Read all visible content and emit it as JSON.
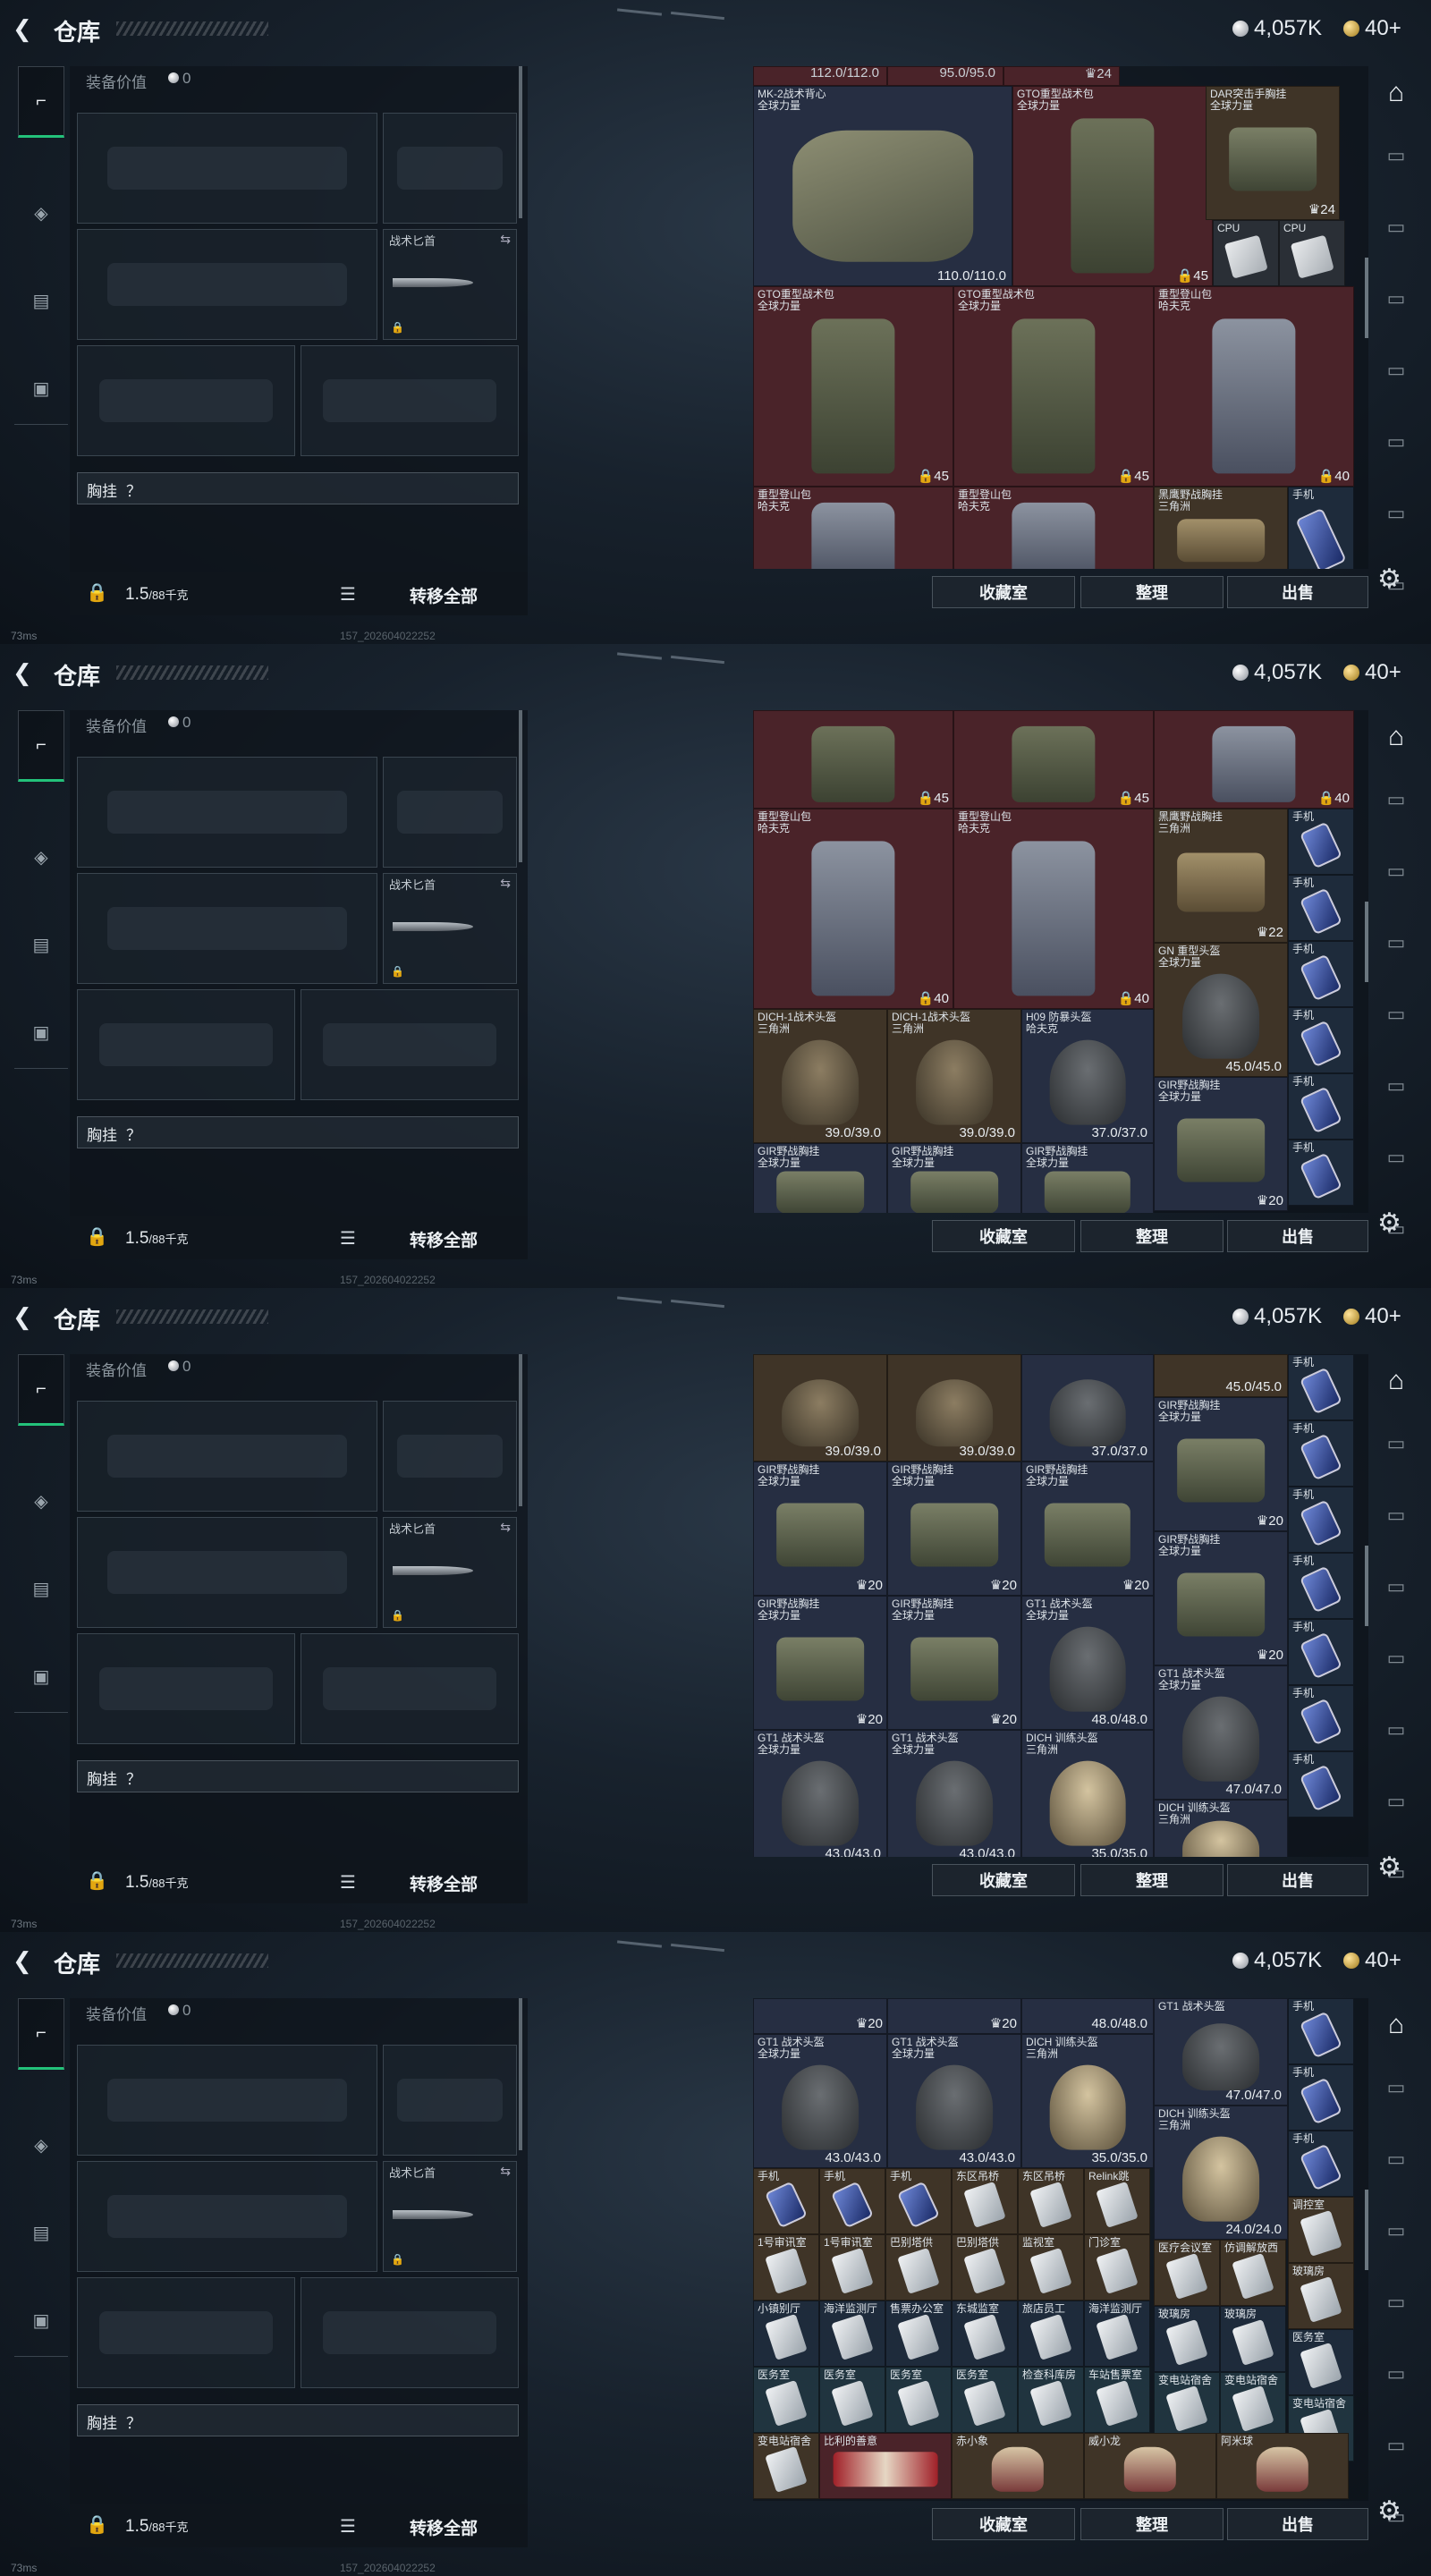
{
  "header": {
    "title": "仓库",
    "silver": "4,057K",
    "gold": "40+"
  },
  "loadout": {
    "value_label": "装备价值",
    "value": "0",
    "knife": "战术匕首",
    "chest_rig": "胸挂",
    "chest_hint": "？",
    "weight": "1.5",
    "weight_unit": "/88千克",
    "transfer_all": "转移全部"
  },
  "status": {
    "ping": "73ms",
    "build": "157_202604022252"
  },
  "actions": {
    "collection": "收藏室",
    "sort": "整理",
    "sell": "出售"
  },
  "icons": {
    "back": "back-arrow-icon",
    "sidebar": [
      "pistol-icon",
      "armor-icon",
      "clipboard-icon",
      "briefcase-icon"
    ],
    "right": [
      "home-icon",
      "inventory-icon",
      "inventory-icon",
      "inventory-icon",
      "inventory-icon",
      "inventory-icon",
      "inventory-icon",
      "inventory-icon"
    ],
    "settings": "gear-icon"
  },
  "screens": [
    {
      "items": [
        {
          "t": "red",
          "p": "none",
          "ntop": "112.0/112.0"
        },
        {
          "t": "red",
          "p": "none",
          "ntop": "95.0/95.0"
        },
        {
          "t": "red",
          "p": "none",
          "ntop": "♛24"
        },
        {
          "t": "blue",
          "n": "MK-2战术背心|全球力量",
          "p": "vest",
          "v": "110.0/110.0"
        },
        {
          "t": "red",
          "n": "GTO重型战术包|全球力量",
          "p": "pack",
          "b": "🔒45"
        },
        {
          "t": "brown",
          "n": "DAR突击手胸挂|全球力量",
          "p": "rig",
          "b": "♛24"
        },
        {
          "t": "gray",
          "n": "CPU",
          "p": "cpu"
        },
        {
          "t": "gray",
          "n": "CPU",
          "p": "cpu"
        },
        {
          "t": "red",
          "n": "GTO重型战术包|全球力量",
          "p": "pack",
          "b": "🔒45"
        },
        {
          "t": "red",
          "n": "GTO重型战术包|全球力量",
          "p": "pack",
          "b": "🔒45"
        },
        {
          "t": "red",
          "n": "重型登山包|哈夫克",
          "p": "gpack",
          "b": "🔒40"
        },
        {
          "t": "red",
          "n": "重型登山包|哈夫克",
          "p": "gpack"
        },
        {
          "t": "red",
          "n": "重型登山包|哈夫克",
          "p": "gpack"
        },
        {
          "t": "brown",
          "n": "黑鹰野战胸挂|三角洲",
          "p": "trig"
        },
        {
          "t": "nav",
          "n": "手机",
          "p": "phone"
        }
      ]
    },
    {
      "items": [
        {
          "t": "red",
          "p": "pack",
          "b": "🔒45"
        },
        {
          "t": "red",
          "p": "pack",
          "b": "🔒45"
        },
        {
          "t": "red",
          "p": "gpack",
          "b": "🔒40"
        },
        {
          "t": "red",
          "n": "重型登山包|哈夫克",
          "p": "gpack",
          "b": "🔒40"
        },
        {
          "t": "red",
          "n": "重型登山包|哈夫克",
          "p": "gpack",
          "b": "🔒40"
        },
        {
          "t": "brown",
          "n": "黑鹰野战胸挂|三角洲",
          "p": "trig",
          "b": "♛22"
        },
        {
          "t": "nav",
          "n": "手机",
          "p": "phone"
        },
        {
          "t": "nav",
          "n": "手机",
          "p": "phone"
        },
        {
          "t": "nav",
          "n": "手机",
          "p": "phone"
        },
        {
          "t": "nav",
          "n": "手机",
          "p": "phone"
        },
        {
          "t": "nav",
          "n": "手机",
          "p": "phone"
        },
        {
          "t": "nav",
          "n": "手机",
          "p": "phone"
        },
        {
          "t": "brown",
          "n": "GN 重型头盔|全球力量",
          "p": "ghelm",
          "v": "45.0/45.0"
        },
        {
          "t": "brown",
          "n": "DICH-1战术头盔|三角洲",
          "p": "helm",
          "v": "39.0/39.0"
        },
        {
          "t": "brown",
          "n": "DICH-1战术头盔|三角洲",
          "p": "helm",
          "v": "39.0/39.0"
        },
        {
          "t": "blue",
          "n": "H09 防暴头盔|哈夫克",
          "p": "ghelm",
          "v": "37.0/37.0"
        },
        {
          "t": "blue",
          "n": "GIR野战胸挂|全球力量",
          "p": "rig",
          "b": "♛20"
        },
        {
          "t": "blue",
          "n": "GIR野战胸挂|全球力量",
          "p": "rig"
        },
        {
          "t": "blue",
          "n": "GIR野战胸挂|全球力量",
          "p": "rig"
        },
        {
          "t": "blue",
          "n": "GIR野战胸挂|全球力量",
          "p": "rig"
        }
      ]
    },
    {
      "items": [
        {
          "t": "brown",
          "p": "helm",
          "v": "39.0/39.0"
        },
        {
          "t": "brown",
          "p": "helm",
          "v": "39.0/39.0"
        },
        {
          "t": "blue",
          "p": "ghelm",
          "v": "37.0/37.0"
        },
        {
          "t": "brown",
          "p": "none",
          "v": "45.0/45.0"
        },
        {
          "t": "blue",
          "n": "GIR野战胸挂|全球力量",
          "p": "rig",
          "b": "♛20"
        },
        {
          "t": "blue",
          "n": "GIR野战胸挂|全球力量",
          "p": "rig",
          "b": "♛20"
        },
        {
          "t": "blue",
          "n": "GIR野战胸挂|全球力量",
          "p": "rig",
          "b": "♛20"
        },
        {
          "t": "blue",
          "n": "GIR野战胸挂|全球力量",
          "p": "rig",
          "b": "♛20"
        },
        {
          "t": "blue",
          "n": "GIR野战胸挂|全球力量",
          "p": "rig",
          "b": "♛20"
        },
        {
          "t": "blue",
          "n": "GIR野战胸挂|全球力量",
          "p": "rig",
          "b": "♛20"
        },
        {
          "t": "blue",
          "n": "GIR野战胸挂|全球力量",
          "p": "rig",
          "b": "♛20"
        },
        {
          "t": "blue",
          "n": "GT1 战术头盔|全球力量",
          "p": "ghelm",
          "v": "48.0/48.0"
        },
        {
          "t": "blue",
          "n": "GT1 战术头盔|全球力量",
          "p": "ghelm",
          "v": "47.0/47.0"
        },
        {
          "t": "blue",
          "n": "GT1 战术头盔|全球力量",
          "p": "ghelm",
          "v": "43.0/43.0"
        },
        {
          "t": "blue",
          "n": "GT1 战术头盔|全球力量",
          "p": "ghelm",
          "v": "43.0/43.0"
        },
        {
          "t": "blue",
          "n": "DICH 训练头盔|三角洲",
          "p": "fhelm",
          "v": "35.0/35.0"
        },
        {
          "t": "blue",
          "n": "DICH 训练头盔|三角洲",
          "p": "fhelm"
        },
        {
          "t": "nav",
          "n": "手机",
          "p": "phone"
        },
        {
          "t": "nav",
          "n": "手机",
          "p": "phone"
        },
        {
          "t": "nav",
          "n": "手机",
          "p": "phone"
        },
        {
          "t": "nav",
          "n": "手机",
          "p": "phone"
        },
        {
          "t": "nav",
          "n": "手机",
          "p": "phone"
        },
        {
          "t": "nav",
          "n": "手机",
          "p": "phone"
        },
        {
          "t": "nav",
          "n": "手机",
          "p": "phone"
        }
      ]
    },
    {
      "items": [
        {
          "t": "blue",
          "p": "none",
          "b": "♛20"
        },
        {
          "t": "blue",
          "p": "none",
          "b": "♛20"
        },
        {
          "t": "blue",
          "p": "none",
          "v": "48.0/48.0"
        },
        {
          "t": "blue",
          "n": "GT1 战术头盔|全球力量",
          "p": "ghelm",
          "v": "43.0/43.0"
        },
        {
          "t": "blue",
          "n": "GT1 战术头盔|全球力量",
          "p": "ghelm",
          "v": "43.0/43.0"
        },
        {
          "t": "blue",
          "n": "DICH 训练头盔|三角洲",
          "p": "fhelm",
          "v": "35.0/35.0"
        },
        {
          "t": "blue",
          "n": "GT1 战术头盔",
          "p": "ghelm",
          "v": "47.0/47.0"
        },
        {
          "t": "blue",
          "n": "DICH 训练头盔|三角洲",
          "p": "fhelm",
          "v": "24.0/24.0"
        },
        {
          "t": "nav",
          "n": "手机",
          "p": "phone"
        },
        {
          "t": "nav",
          "n": "手机",
          "p": "phone"
        },
        {
          "t": "nav",
          "n": "手机",
          "p": "phone"
        },
        {
          "t": "brown",
          "n": "手机",
          "p": "phone"
        },
        {
          "t": "brown",
          "n": "手机",
          "p": "phone"
        },
        {
          "t": "brown",
          "n": "手机",
          "p": "phone"
        },
        {
          "t": "brown",
          "n": "东区吊桥",
          "p": "card"
        },
        {
          "t": "brown",
          "n": "东区吊桥",
          "p": "card"
        },
        {
          "t": "brown",
          "n": "Relink跳",
          "p": "card"
        },
        {
          "t": "brown",
          "n": "调控室",
          "p": "card"
        },
        {
          "t": "brown",
          "n": "1号审讯室",
          "p": "card"
        },
        {
          "t": "brown",
          "n": "1号审讯室",
          "p": "card"
        },
        {
          "t": "brown",
          "n": "巴别塔供",
          "p": "card"
        },
        {
          "t": "brown",
          "n": "巴别塔供",
          "p": "card"
        },
        {
          "t": "brown",
          "n": "监视室",
          "p": "card"
        },
        {
          "t": "brown",
          "n": "门诊室",
          "p": "card"
        },
        {
          "t": "brown",
          "n": "医疗会议室",
          "p": "card"
        },
        {
          "t": "brown",
          "n": "仿调解放西",
          "p": "card"
        },
        {
          "t": "brown",
          "n": "玻璃房",
          "p": "card"
        },
        {
          "t": "nav",
          "n": "小镇别厅",
          "p": "card"
        },
        {
          "t": "nav",
          "n": "海洋监测厅",
          "p": "card"
        },
        {
          "t": "nav",
          "n": "售票办公室",
          "p": "card"
        },
        {
          "t": "nav",
          "n": "东城监室",
          "p": "card"
        },
        {
          "t": "nav",
          "n": "旅店员工",
          "p": "card"
        },
        {
          "t": "nav",
          "n": "海洋监测厅",
          "p": "card"
        },
        {
          "t": "nav",
          "n": "玻璃房",
          "p": "card"
        },
        {
          "t": "nav",
          "n": "玻璃房",
          "p": "card"
        },
        {
          "t": "nav",
          "n": "医务室",
          "p": "card"
        },
        {
          "t": "teal",
          "n": "医务室",
          "p": "card"
        },
        {
          "t": "teal",
          "n": "医务室",
          "p": "card"
        },
        {
          "t": "teal",
          "n": "医务室",
          "p": "card"
        },
        {
          "t": "teal",
          "n": "医务室",
          "p": "card"
        },
        {
          "t": "teal",
          "n": "检查科库房",
          "p": "card"
        },
        {
          "t": "teal",
          "n": "车站售票室",
          "p": "card"
        },
        {
          "t": "teal",
          "n": "变电站宿舍",
          "p": "card"
        },
        {
          "t": "teal",
          "n": "变电站宿舍",
          "p": "card"
        },
        {
          "t": "teal",
          "n": "变电站宿舍",
          "p": "card"
        },
        {
          "t": "brown",
          "n": "变电站宿舍",
          "p": "card"
        },
        {
          "t": "red",
          "n": "比利的善意",
          "p": "rich"
        },
        {
          "t": "brown",
          "n": "赤小象",
          "p": "doll"
        },
        {
          "t": "brown",
          "n": "威小龙",
          "p": "doll"
        },
        {
          "t": "brown",
          "n": "阿米球",
          "p": "doll"
        }
      ]
    }
  ]
}
